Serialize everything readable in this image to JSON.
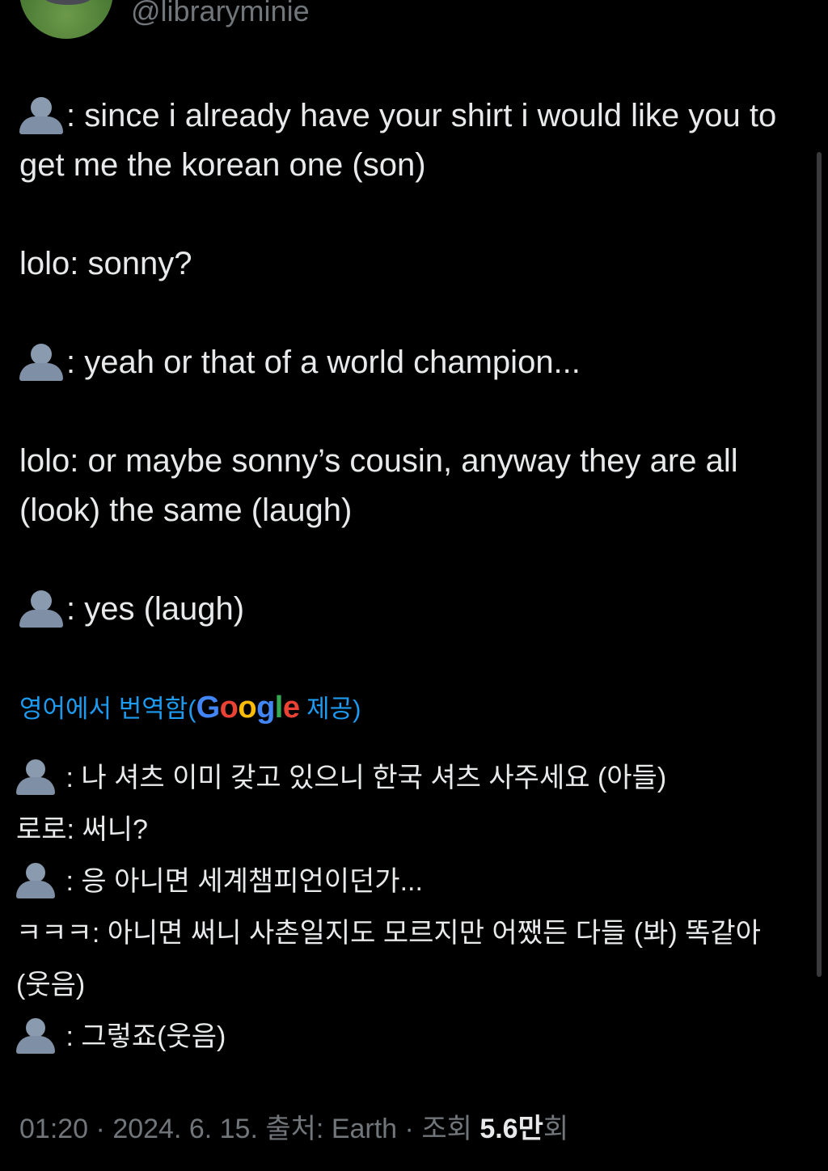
{
  "profile": {
    "handle": "@libraryminie",
    "avatar_icon": "avatar-icon"
  },
  "tweet": {
    "line1_rest": ": since i already have your shirt i would like you to get me the korean one (son)",
    "line2": "lolo:  sonny?",
    "line3_rest": ": yeah or that of a world champion...",
    "line4": "lolo: or maybe sonny’s cousin, anyway they are all (look) the same (laugh)",
    "line5_rest": ":  yes (laugh)"
  },
  "translation": {
    "label_before": "영어에서 번역함(",
    "google_letters": [
      "G",
      "o",
      "o",
      "g",
      "l",
      "e"
    ],
    "label_after": " 제공)",
    "line1_rest": " : 나 셔츠 이미 갖고 있으니 한국 셔츠 사주세요 (아들)",
    "line2": "로로: 써니?",
    "line3_rest": " : 응 아니면 세계챔피언이던가...",
    "line4": "ㅋㅋㅋ: 아니면 써니 사촌일지도 모르지만 어쨌든 다들 (봐) 똑같아 (웃음)",
    "line5_rest": " : 그렇죠(웃음)"
  },
  "meta": {
    "time": "01:20",
    "sep1": " · ",
    "date": "2024. 6. 15.",
    "source_label": " 출처: Earth",
    "sep2": " · ",
    "views_label": "조회 ",
    "views_count": "5.6만",
    "views_suffix": "회"
  },
  "colors": {
    "background": "#000000",
    "text": "#e7e9ea",
    "muted": "#71767b",
    "link": "#1d9bf0"
  }
}
